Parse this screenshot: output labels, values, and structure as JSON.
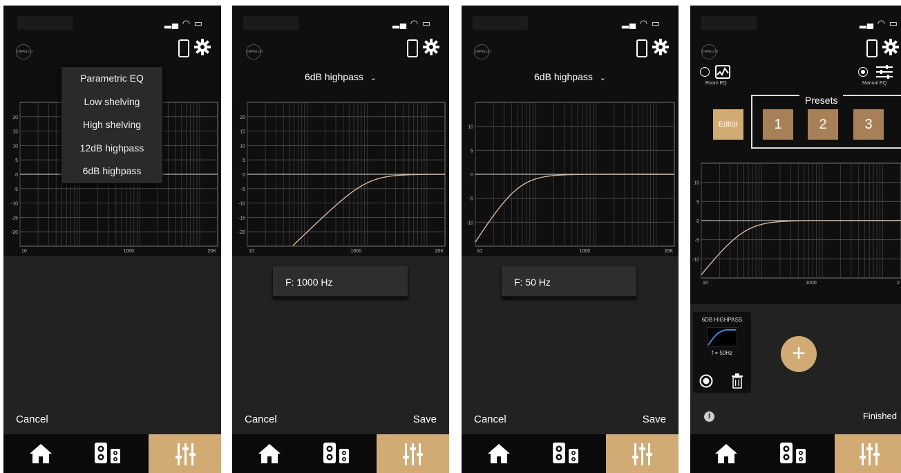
{
  "screen1": {
    "dropdown": [
      "Parametric EQ",
      "Low shelving",
      "High shelving",
      "12dB highpass",
      "6dB highpass"
    ],
    "y_ticks": [
      "20",
      "15",
      "10",
      "5",
      "0",
      "-5",
      "-10",
      "-15",
      "-20"
    ],
    "x_ticks": [
      "10",
      "1000",
      "20K"
    ],
    "cancel": "Cancel"
  },
  "screen2": {
    "title": "6dB highpass",
    "y_ticks": [
      "20",
      "15",
      "10",
      "5",
      "0",
      "-5",
      "-10",
      "-15",
      "-20"
    ],
    "x_ticks": [
      "10",
      "1000",
      "20K"
    ],
    "frequency": "F: 1000 Hz",
    "cancel": "Cancel",
    "save": "Save"
  },
  "screen3": {
    "title": "6dB highpass",
    "y_ticks": [
      "10",
      "5",
      "0",
      "-5",
      "-10"
    ],
    "x_ticks": [
      "10",
      "1000",
      "20K"
    ],
    "frequency": "F: 50 Hz",
    "cancel": "Cancel",
    "save": "Save"
  },
  "screen4": {
    "room_eq": "Room EQ",
    "manual_eq": "Manual EQ",
    "presets_label": "Presets",
    "editor": "Editor",
    "presets": [
      "1",
      "2",
      "3"
    ],
    "y_ticks": [
      "10",
      "5",
      "0",
      "-5",
      "-10"
    ],
    "x_ticks": [
      "10",
      "1000",
      "2"
    ],
    "card_title": "6DB HIGHPASS",
    "card_freq": "f = 50Hz",
    "finished": "Finished"
  },
  "logo_text": "CAPELLO",
  "colors": {
    "accent": "#d1aa74",
    "tile": "#a88058",
    "curve": "#d8b9a0"
  }
}
